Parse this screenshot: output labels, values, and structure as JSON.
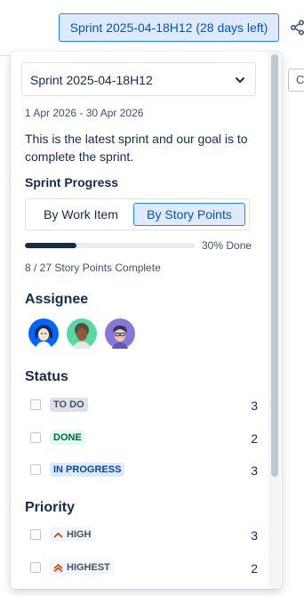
{
  "header": {
    "sprint_button": "Sprint 2025-04-18H12 (28 days left)",
    "share_icon": "share-icon"
  },
  "background": {
    "partial_input_text": "C"
  },
  "panel": {
    "sprint_select": "Sprint 2025-04-18H12",
    "date_range": "1 Apr 2026 - 30 Apr 2026",
    "goal": "This is the latest sprint and our goal is to complete the sprint.",
    "progress_heading": "Sprint Progress",
    "toggle": {
      "by_work_item": "By Work Item",
      "by_story_points": "By Story Points",
      "selected": "By Story Points"
    },
    "progress": {
      "fraction": 0.3,
      "label": "30% Done",
      "points_complete": "8 / 27 Story Points Complete"
    },
    "assignee_heading": "Assignee",
    "status_heading": "Status",
    "statuses": [
      {
        "label": "TO DO",
        "count": "3"
      },
      {
        "label": "DONE",
        "count": "2"
      },
      {
        "label": "IN PROGRESS",
        "count": "3"
      }
    ],
    "priority_heading": "Priority",
    "priorities": [
      {
        "label": "HIGH",
        "count": "3",
        "icon": "chevron-up-icon"
      },
      {
        "label": "HIGHEST",
        "count": "2",
        "icon": "double-chevron-up-icon"
      }
    ]
  },
  "colors": {
    "accent": "#0052cc",
    "accent_bg": "#deebff",
    "progress_fill": "#172b4d",
    "done_green": "#006644",
    "priority_red": "#de350b"
  }
}
